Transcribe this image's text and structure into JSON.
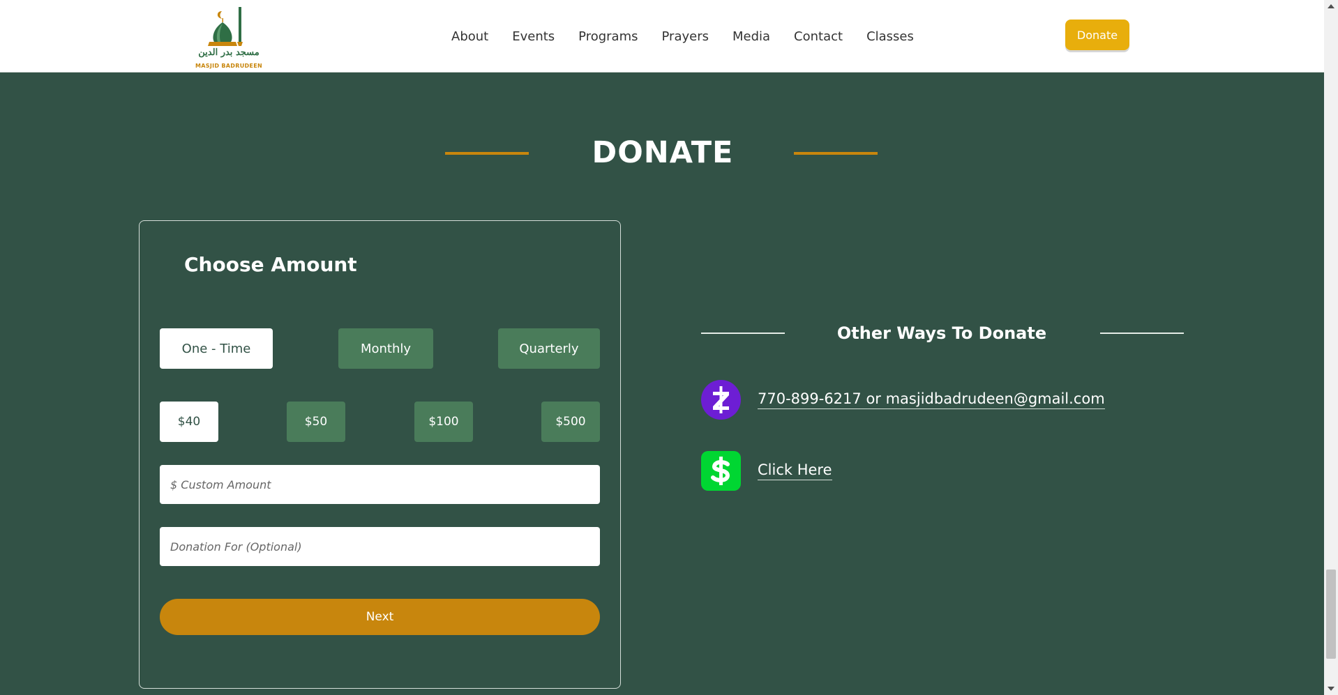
{
  "header": {
    "logo_arabic": "مسجد بدر الدين",
    "logo_text": "MASJID BADRUDEEN",
    "nav": [
      "About",
      "Events",
      "Programs",
      "Prayers",
      "Media",
      "Contact",
      "Classes"
    ],
    "donate_label": "Donate"
  },
  "section": {
    "title": "DONATE"
  },
  "form": {
    "title": "Choose Amount",
    "frequencies": [
      "One - Time",
      "Monthly",
      "Quarterly"
    ],
    "selected_frequency": "One - Time",
    "amounts": [
      "$40",
      "$50",
      "$100",
      "$500"
    ],
    "selected_amount": "$40",
    "custom_amount_placeholder": "$ Custom Amount",
    "donation_for_placeholder": "Donation For (Optional)",
    "next_label": "Next"
  },
  "other_ways": {
    "title": "Other Ways To Donate",
    "methods": [
      {
        "icon": "zelle-icon",
        "label": "770-899-6217 or masjidbadrudeen@gmail.com"
      },
      {
        "icon": "cashapp-icon",
        "label": "Click Here"
      }
    ]
  },
  "colors": {
    "background": "#325246",
    "accent": "#c8860d",
    "button_green": "#4a7c5a",
    "header_donate": "#e8ae0c",
    "zelle": "#6d1ed4",
    "cashapp": "#00d632"
  }
}
